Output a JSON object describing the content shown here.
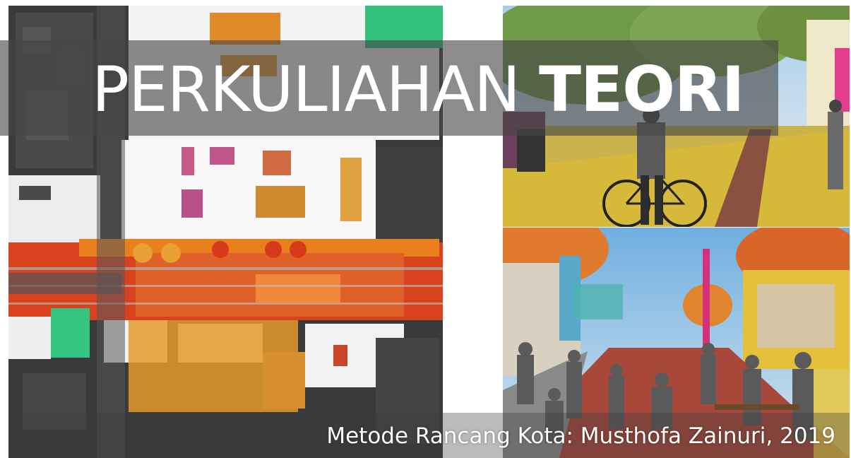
{
  "slide": {
    "title_light": "PERKULIAHAN",
    "title_bold": "TEORI",
    "subtitle": "Metode Rancang Kota: Musthofa Zainuri, 2019"
  },
  "images": [
    {
      "name": "urban-design-site-plan",
      "kind": "illustration"
    },
    {
      "name": "street-cycling-rendering",
      "kind": "illustration"
    },
    {
      "name": "pedestrian-plaza-rendering",
      "kind": "illustration"
    }
  ],
  "colors": {
    "title_band": "#464646",
    "title_text": "#ffffff",
    "plan_dark": "#3a3a3a",
    "plan_orange": "#e8801e",
    "plan_red": "#d73a1f",
    "green_patch": "#2fc37a"
  }
}
